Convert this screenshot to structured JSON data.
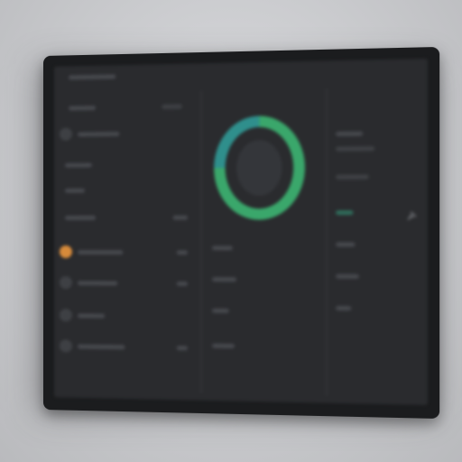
{
  "colors": {
    "background": "#c9cacd",
    "bezel": "#1b1c1e",
    "screen": "#2a2b2e",
    "accent_orange": "#d68a3a",
    "ring_green": "#3aa76b",
    "ring_teal": "#2f8f8c"
  },
  "donut": {
    "percent": 75,
    "segments": [
      {
        "color": "#3aa76b",
        "value": 0.75
      },
      {
        "color": "#2f8f8c",
        "value": 0.25
      }
    ]
  },
  "icons": [
    "pin-icon",
    "status-dot-icon",
    "avatar-icon"
  ]
}
